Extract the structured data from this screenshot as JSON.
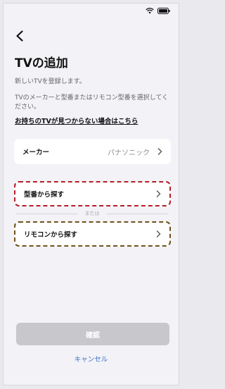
{
  "header": {
    "back_icon": "chevron-left-icon",
    "title": "TVの追加"
  },
  "status_bar": {
    "wifi_icon": "wifi-icon",
    "battery_icon": "battery-icon"
  },
  "content": {
    "description": "新しいTVを登録します。",
    "instruction": "TVのメーカーと型番またはリモコン型番を選択してください。",
    "help_link": "お持ちのTVが見つからない場合はこちら"
  },
  "maker_row": {
    "label": "メーカー",
    "value": "パナソニック"
  },
  "search_by_model": {
    "label": "型番から探す",
    "border_color": "#b41e2a"
  },
  "divider": {
    "text": "または"
  },
  "search_by_remote": {
    "label": "リモコンから探す",
    "border_color": "#6f5219"
  },
  "footer": {
    "confirm_label": "確認",
    "cancel_label": "キャンセル"
  },
  "colors": {
    "background": "#f2f2f7",
    "link": "#3b6fc4",
    "disabled_button": "#c7c7cc"
  }
}
